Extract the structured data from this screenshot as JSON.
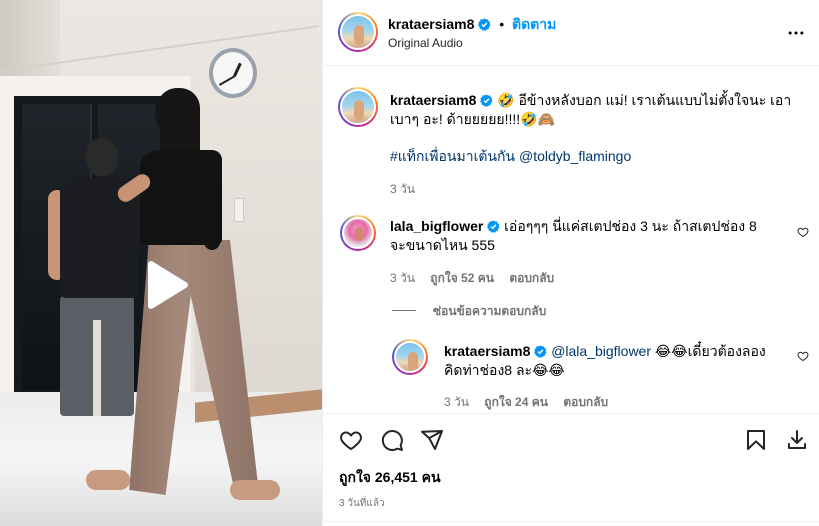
{
  "post": {
    "author": "krataersiam8",
    "follow_label": "ติดตาม",
    "audio": "Original Audio",
    "more_icon": "more-horizontal-icon"
  },
  "caption": {
    "author": "krataersiam8",
    "text": "🤣 อีข้างหลังบอก แม่! เราเต้นแบบไม่ตั้งใจนะ เอาเบาๆ อะ! ด้ายยยยย!!!!🤣🙈",
    "hashtag": "#แท็กเพื่อนมาเต้นกัน",
    "mention": "@toldyb_flamingo",
    "time": "3 วัน"
  },
  "comments": [
    {
      "author": "lala_bigflower",
      "text": "เอ่อๆๆๆ นี่แค่สเตปช่อง 3 นะ ถ้าสเตปช่อง 8 จะขนาดไหน 555",
      "time": "3 วัน",
      "likes": "ถูกใจ 52 คน",
      "reply": "ตอบกลับ",
      "hide_replies": "ซ่อนข้อความตอบกลับ"
    }
  ],
  "reply": {
    "author": "krataersiam8",
    "mention": "@lala_bigflower",
    "text": "😂😂เดี๋ยวต้องลองคิดท่าช่อง8 ละ😂😂",
    "time": "3 วัน",
    "likes": "ถูกใจ 24 คน",
    "reply": "ตอบกลับ"
  },
  "actions": {
    "likes_count": "ถูกใจ 26,451 คน",
    "posted": "3 วันที่แล้ว"
  },
  "colors": {
    "accent": "#0095f6",
    "muted": "#737373",
    "link": "#00376b"
  }
}
